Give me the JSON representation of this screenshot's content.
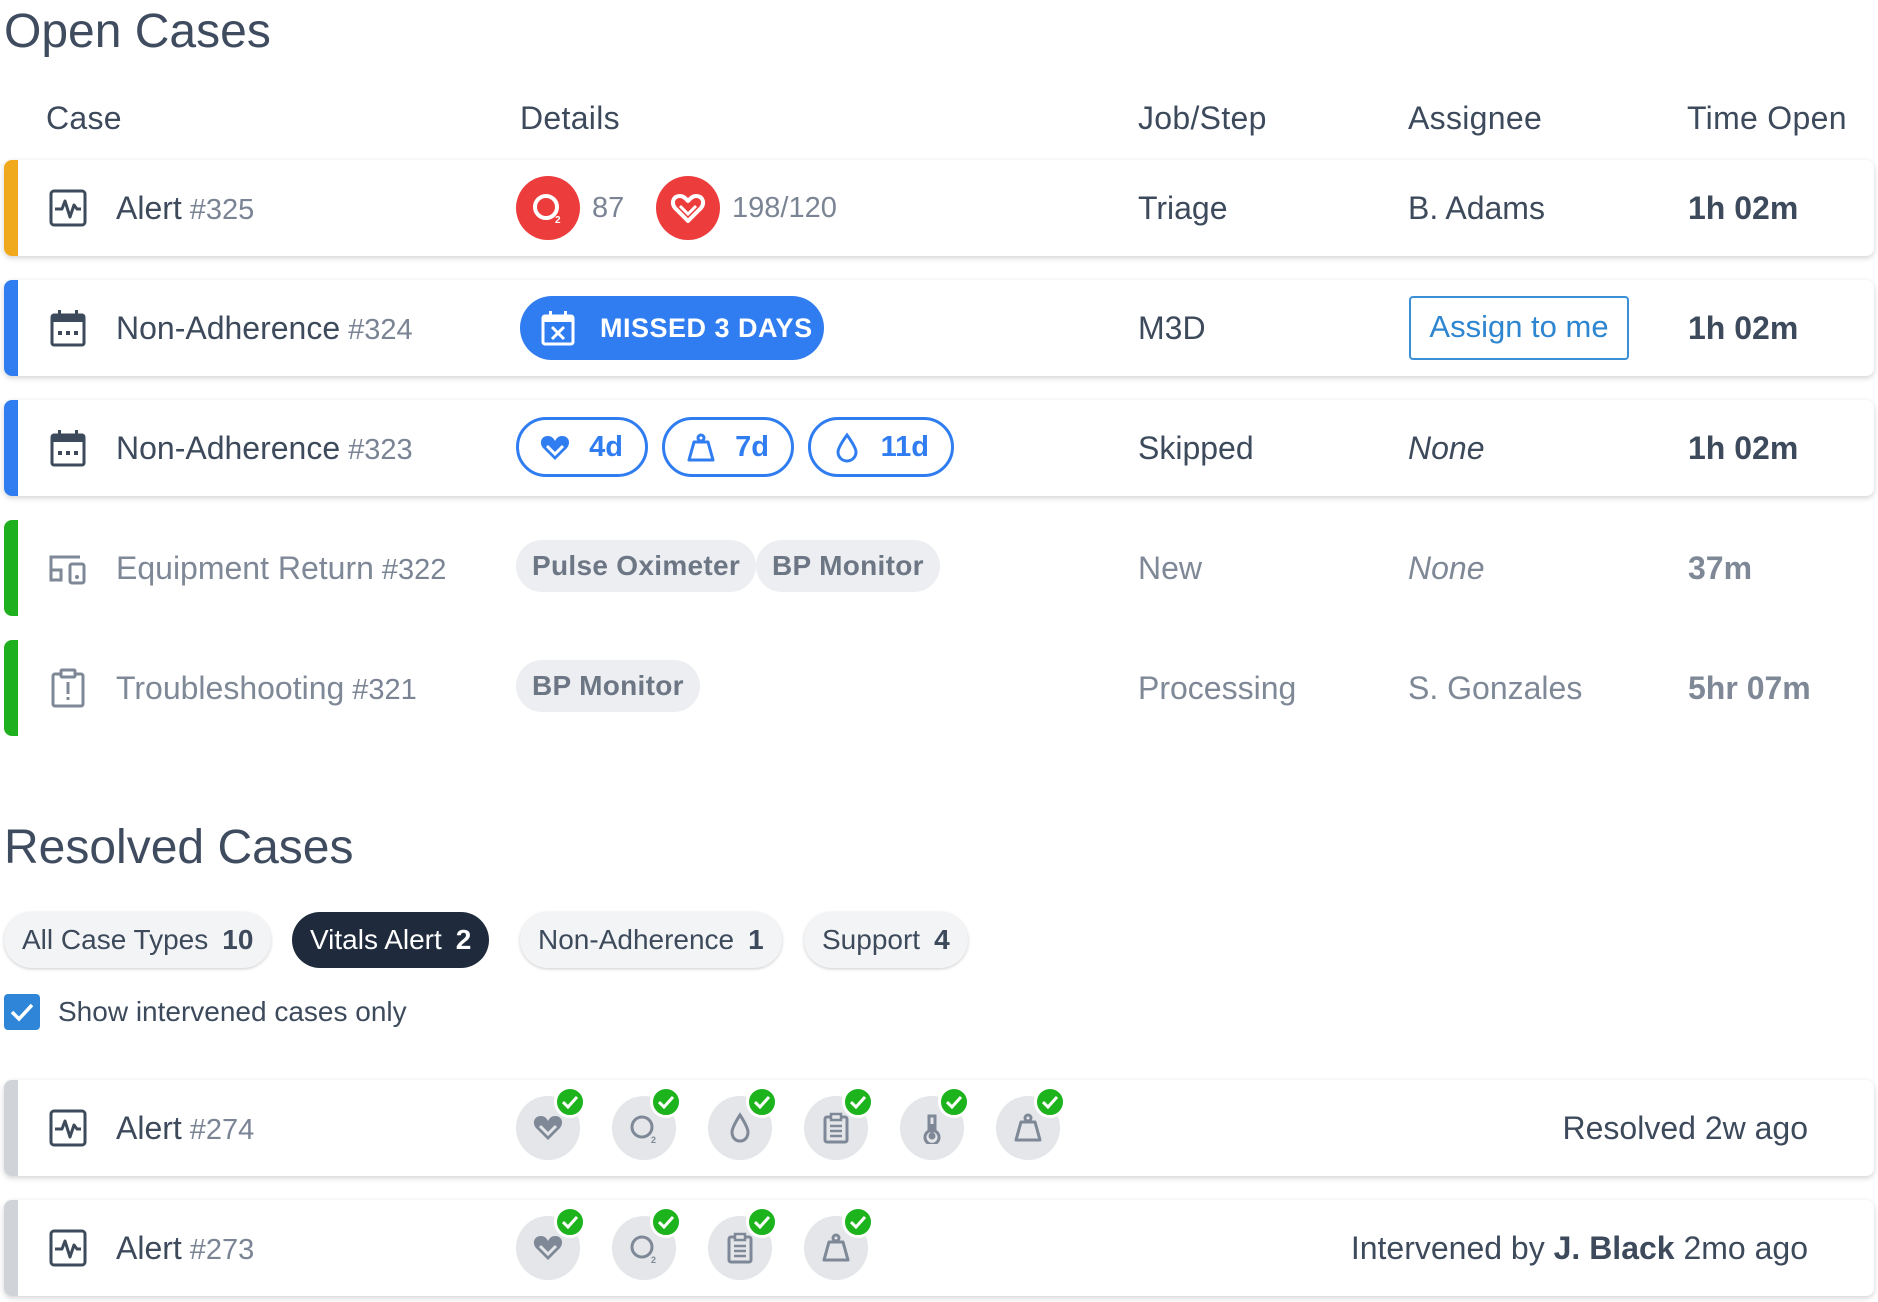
{
  "open": {
    "title": "Open Cases",
    "columns": {
      "case": "Case",
      "details": "Details",
      "job": "Job/Step",
      "assignee": "Assignee",
      "time": "Time Open"
    },
    "rows": [
      {
        "title": "Alert",
        "number": "#325",
        "bar_color": "#f0a81c",
        "icon": "activity-icon",
        "vitals": [
          {
            "icon": "oxygen-icon",
            "value": "87"
          },
          {
            "icon": "heart-icon",
            "value": "198/120"
          }
        ],
        "job": "Triage",
        "assignee": "B. Adams",
        "time": "1h 02m"
      },
      {
        "title": "Non-Adherence",
        "number": "#324",
        "bar_color": "#2f7df0",
        "icon": "calendar-icon",
        "badge": "MISSED 3 DAYS",
        "job": "M3D",
        "assignee_button": "Assign to me",
        "time": "1h 02m"
      },
      {
        "title": "Non-Adherence",
        "number": "#323",
        "bar_color": "#2f7df0",
        "icon": "calendar-icon",
        "pills": [
          {
            "icon": "heart-icon",
            "value": "4d"
          },
          {
            "icon": "weight-icon",
            "value": "7d"
          },
          {
            "icon": "drop-icon",
            "value": "11d"
          }
        ],
        "job": "Skipped",
        "assignee": "None",
        "time": "1h 02m"
      },
      {
        "title": "Equipment Return",
        "number": "#322",
        "bar_color": "#1fb01f",
        "icon": "devices-icon",
        "tags": [
          "Pulse Oximeter",
          "BP Monitor"
        ],
        "job": "New",
        "assignee": "None",
        "time": "37m"
      },
      {
        "title": "Troubleshooting",
        "number": "#321",
        "bar_color": "#1fb01f",
        "icon": "clipboard-alert-icon",
        "tags": [
          "BP Monitor"
        ],
        "job": "Processing",
        "assignee": "S. Gonzales",
        "time": "5hr 07m"
      }
    ]
  },
  "resolved": {
    "title": "Resolved Cases",
    "filters": [
      {
        "label": "All Case Types",
        "count": "10",
        "active": false
      },
      {
        "label": "Vitals Alert",
        "count": "2",
        "active": true
      },
      {
        "label": "Non-Adherence",
        "count": "1",
        "active": false
      },
      {
        "label": "Support",
        "count": "4",
        "active": false
      }
    ],
    "checkbox_label": "Show intervened cases only",
    "checkbox_checked": true,
    "rows": [
      {
        "title": "Alert",
        "number": "#274",
        "icons": [
          "heart-icon",
          "oxygen-icon",
          "drop-icon",
          "clipboard-icon",
          "thermometer-icon",
          "weight-icon"
        ],
        "status": "Resolved 2w ago"
      },
      {
        "title": "Alert",
        "number": "#273",
        "icons": [
          "heart-icon",
          "oxygen-icon",
          "clipboard-icon",
          "weight-icon"
        ],
        "status_prefix": "Intervened by",
        "status_name": "J. Black",
        "status_suffix": "2mo ago"
      }
    ]
  },
  "colors": {
    "primary": "#2f7df0",
    "alert_red": "#ec3c3c",
    "dark": "#1f2b3c",
    "success": "#1db31d"
  }
}
